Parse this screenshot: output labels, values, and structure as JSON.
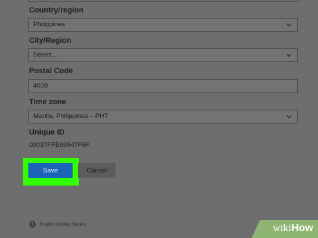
{
  "form": {
    "country_label": "Country/region",
    "country_value": "Philippines",
    "city_label": "City/Region",
    "city_value": "Select...",
    "postal_label": "Postal Code",
    "postal_value": "4009",
    "timezone_label": "Time zone",
    "timezone_value": "Manila, Philippines – PHT",
    "unique_id_label": "Unique ID",
    "unique_id_value": "00037FFE09547F6F"
  },
  "actions": {
    "save_label": "Save",
    "cancel_label": "Cancel"
  },
  "footer": {
    "language": "English (United States)",
    "watermark": "wikiHow"
  },
  "colors": {
    "background": "#6e6e6e",
    "save_button": "#1a63b8",
    "highlight": "#33ff00",
    "watermark_bg": "#8fb572"
  },
  "icons": {
    "dropdown": "chevron-down-icon",
    "language": "globe-icon"
  }
}
